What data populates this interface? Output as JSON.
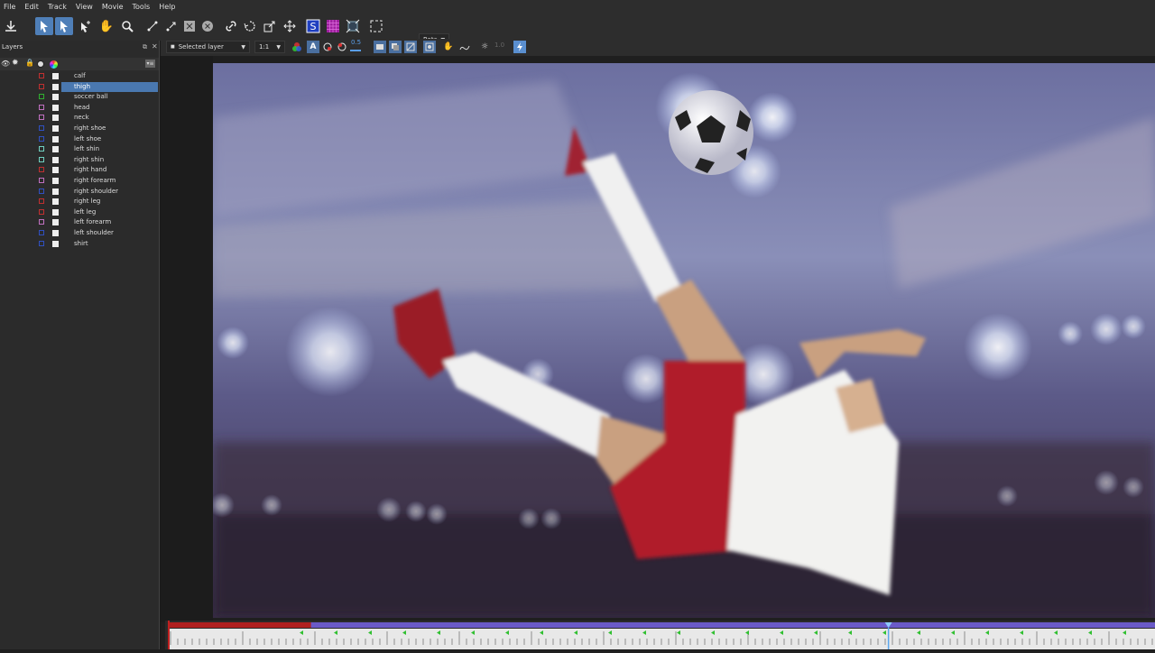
{
  "menu": [
    "File",
    "Edit",
    "Track",
    "View",
    "Movie",
    "Tools",
    "Help"
  ],
  "toolbar": {
    "rotate_dropdown": "Rotc",
    "layer_dropdown": "Selected layer",
    "zoom_dropdown": "1:1",
    "opacity_value": "0.5",
    "exposure_value": "1.0"
  },
  "layers_panel": {
    "title": "Layers",
    "items": [
      {
        "label": "calf",
        "color": "#c03030",
        "selected": false
      },
      {
        "label": "thigh",
        "color": "#c03030",
        "selected": true
      },
      {
        "label": "soccer ball",
        "color": "#30b030",
        "selected": false
      },
      {
        "label": "head",
        "color": "#c070c0",
        "selected": false
      },
      {
        "label": "neck",
        "color": "#c070c0",
        "selected": false
      },
      {
        "label": "right shoe",
        "color": "#3050c0",
        "selected": false
      },
      {
        "label": "left shoe",
        "color": "#3050c0",
        "selected": false
      },
      {
        "label": "left shin",
        "color": "#70d0c0",
        "selected": false
      },
      {
        "label": "right shin",
        "color": "#70d0c0",
        "selected": false
      },
      {
        "label": "right hand",
        "color": "#c03030",
        "selected": false
      },
      {
        "label": "right forearm",
        "color": "#c070c0",
        "selected": false
      },
      {
        "label": "right shoulder",
        "color": "#3050c0",
        "selected": false
      },
      {
        "label": "right leg",
        "color": "#c03030",
        "selected": false
      },
      {
        "label": "left leg",
        "color": "#c03030",
        "selected": false
      },
      {
        "label": "left forearm",
        "color": "#c070c0",
        "selected": false
      },
      {
        "label": "left shoulder",
        "color": "#3050c0",
        "selected": false
      },
      {
        "label": "shirt",
        "color": "#3050c0",
        "selected": false
      }
    ]
  },
  "timeline": {
    "tracked_fraction": 0.145,
    "playhead_fraction": 0.73
  },
  "colors": {
    "accent": "#4f7fb8",
    "tracked": "#b02020",
    "range": "#6a5ac8",
    "keyframe": "#30c030"
  }
}
